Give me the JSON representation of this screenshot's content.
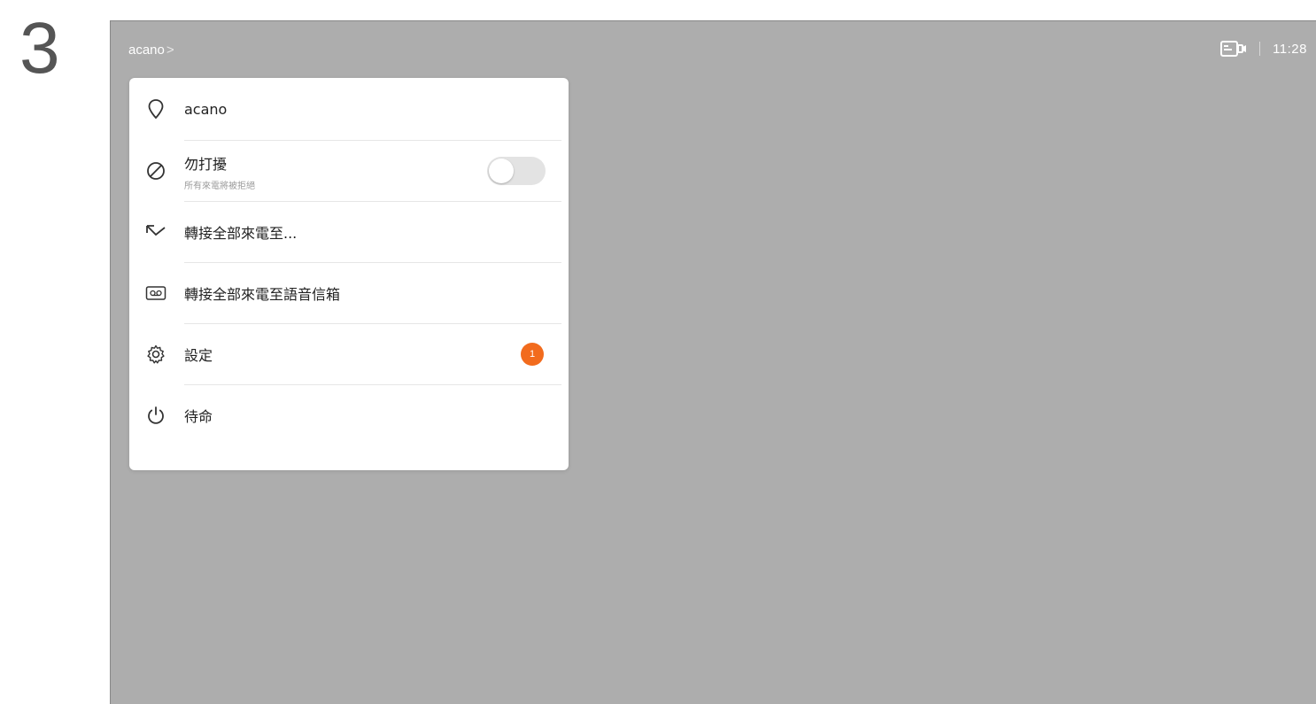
{
  "step": "3",
  "topbar": {
    "breadcrumb": "acano",
    "breadcrumb_chevron": ">",
    "camera_icon": "camera-self-view-icon",
    "time": "11:28"
  },
  "menu": {
    "location": {
      "icon": "location-pin-icon",
      "label": "acano"
    },
    "dnd": {
      "icon": "do-not-disturb-icon",
      "label": "勿打擾",
      "sublabel": "所有來電將被拒絕",
      "toggle_on": false
    },
    "forward": {
      "icon": "call-forward-icon",
      "label": "轉接全部來電至..."
    },
    "voicemail": {
      "icon": "voicemail-icon",
      "label": "轉接全部來電至語音信箱"
    },
    "settings": {
      "icon": "gear-icon",
      "label": "設定",
      "badge": "1"
    },
    "standby": {
      "icon": "power-icon",
      "label": "待命"
    }
  },
  "colors": {
    "screen_bg": "#adadad",
    "menu_bg": "#ffffff",
    "badge": "#f26b1d",
    "toggle_off": "#e3e3e3"
  }
}
